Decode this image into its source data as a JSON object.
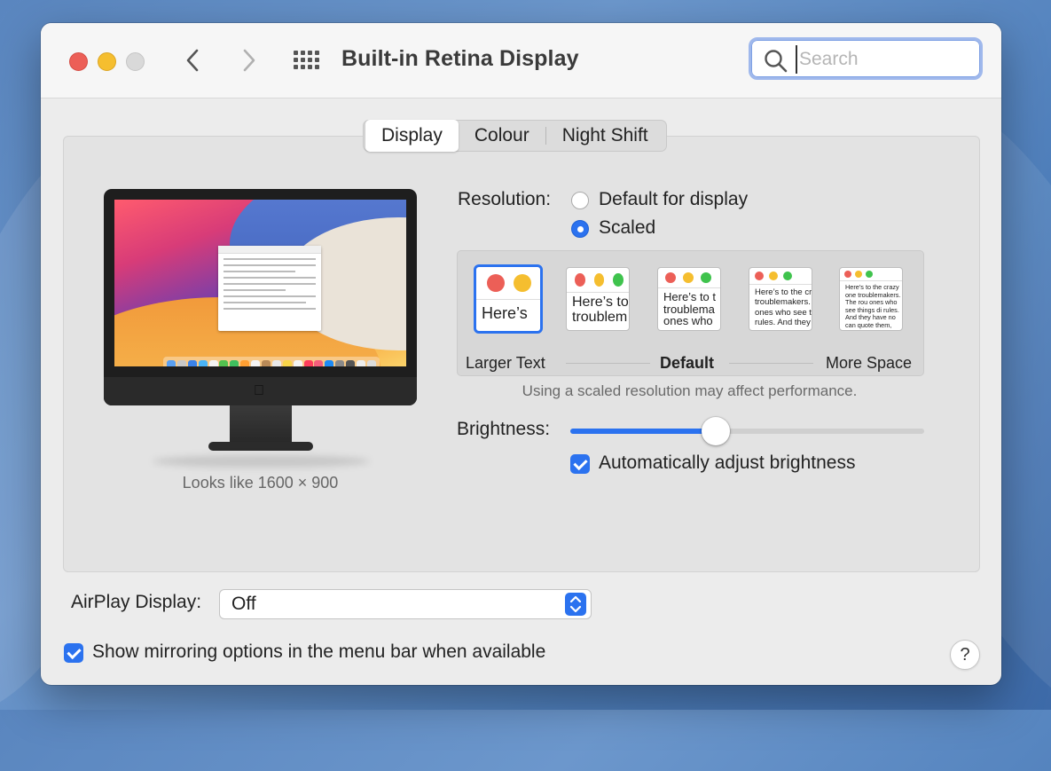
{
  "window": {
    "title": "Built-in Retina Display"
  },
  "search": {
    "placeholder": "Search",
    "value": ""
  },
  "tabs": [
    {
      "label": "Display",
      "active": true
    },
    {
      "label": "Colour",
      "active": false
    },
    {
      "label": "Night Shift",
      "active": false
    }
  ],
  "display": {
    "looks_like": "Looks like 1600 × 900",
    "resolution_label": "Resolution:",
    "resolution_options": [
      {
        "label": "Default for display",
        "selected": false
      },
      {
        "label": "Scaled",
        "selected": true
      }
    ],
    "scale_options": [
      {
        "preview_text": "Here’s",
        "selected": true
      },
      {
        "preview_text": "Here’s to troublem",
        "selected": false
      },
      {
        "preview_text": "Here’s to t troublema ones who",
        "selected": false
      },
      {
        "preview_text": "Here’s to the cr troublemakers. ones who see t rules. And they",
        "selected": false
      },
      {
        "preview_text": "Here’s to the crazy one troublemakers. The rou ones who see things di rules. And they have no can quote them, disagr them. About the only th Because they change th",
        "selected": false
      }
    ],
    "scale_labels": {
      "left": "Larger Text",
      "center": "Default",
      "right": "More Space"
    },
    "performance_note": "Using a scaled resolution may affect performance.",
    "brightness_label": "Brightness:",
    "brightness_level": 0.41,
    "auto_brightness_label": "Automatically adjust brightness",
    "auto_brightness_checked": true
  },
  "airplay": {
    "label": "AirPlay Display:",
    "value": "Off"
  },
  "mirroring": {
    "label": "Show mirroring options in the menu bar when available",
    "checked": true
  },
  "help": {
    "label": "?"
  },
  "colors": {
    "accent": "#2b72ef",
    "traffic_red": "#ec5f57",
    "traffic_yellow": "#f5be2f",
    "traffic_inactive": "#d9d9d9"
  },
  "icons": {
    "back": "chevron-left-icon",
    "forward": "chevron-right-icon",
    "grid": "grid-icon",
    "search": "search-icon",
    "apple": "apple-logo-icon"
  }
}
